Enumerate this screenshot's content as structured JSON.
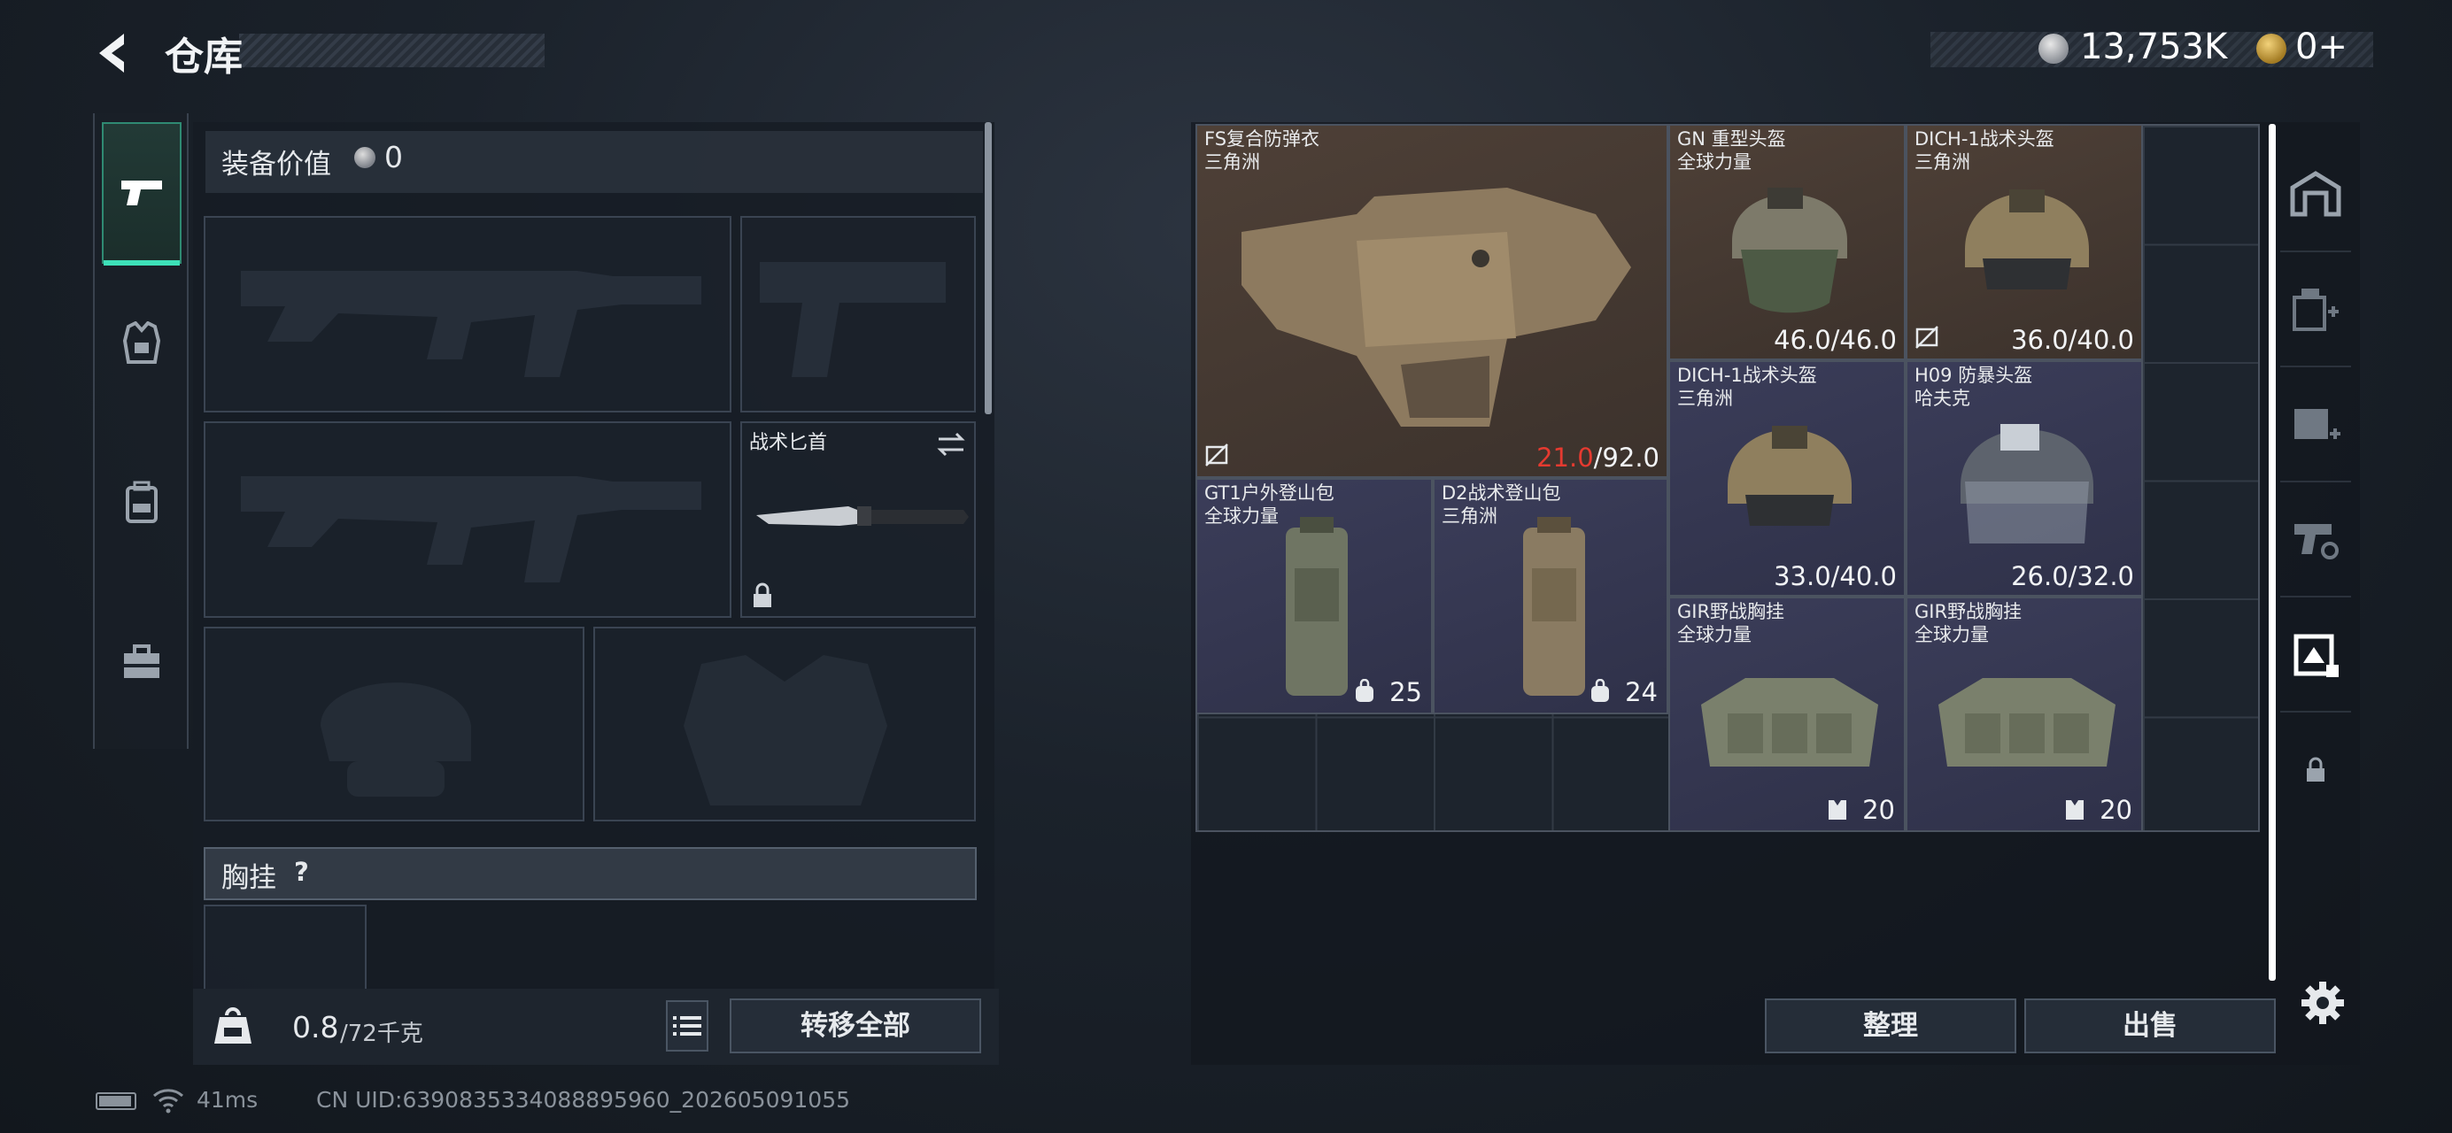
{
  "header": {
    "title": "仓库"
  },
  "currency": {
    "money": "13,753K",
    "tokens": "0+"
  },
  "left_panel": {
    "equipment_value_label": "装备价值",
    "equipment_value": "0",
    "melee_slot_label": "战术匕首",
    "vest_label": "胸挂",
    "vest_help": "?",
    "weight_current": "0.8",
    "weight_max": "/72千克",
    "transfer_all": "转移全部"
  },
  "items": [
    {
      "name": "FS复合防弹衣",
      "sub": "三角洲",
      "dur_cur": "21.0",
      "dur_max": "/92.0",
      "rarity": "brown"
    },
    {
      "name": "GN 重型头盔",
      "sub": "全球力量",
      "durability": "46.0/46.0",
      "rarity": "brown"
    },
    {
      "name": "DICH-1战术头盔",
      "sub": "三角洲",
      "durability": "36.0/40.0",
      "rarity": "brown"
    },
    {
      "name": "DICH-1战术头盔",
      "sub": "三角洲",
      "durability": "33.0/40.0",
      "rarity": "purple"
    },
    {
      "name": "H09 防暴头盔",
      "sub": "哈夫克",
      "durability": "26.0/32.0",
      "rarity": "purple"
    },
    {
      "name": "GT1户外登山包",
      "sub": "全球力量",
      "capacity": "25",
      "rarity": "purple"
    },
    {
      "name": "D2战术登山包",
      "sub": "三角洲",
      "capacity": "24",
      "rarity": "purple"
    },
    {
      "name": "GIR野战胸挂",
      "sub": "全球力量",
      "capacity": "20",
      "rarity": "purple"
    },
    {
      "name": "GIR野战胸挂",
      "sub": "全球力量",
      "capacity": "20",
      "rarity": "purple"
    }
  ],
  "buttons": {
    "organize": "整理",
    "sell": "出售"
  },
  "status_bar": {
    "ping": "41ms",
    "uid": "CN UID:6390835334088895960_202605091055"
  },
  "colors": {
    "accent": "#3de0b8",
    "rarity_brown": "#4e4037",
    "rarity_purple": "#3b3d59",
    "durability_low": "#e53a30"
  },
  "icons": [
    "back-arrow-icon",
    "silver-coin-icon",
    "gold-coin-icon",
    "pistol-icon",
    "armor-icon",
    "backpack-icon",
    "toolbox-icon",
    "swap-icon",
    "lock-icon",
    "weight-icon",
    "list-icon",
    "broken-icon",
    "capacity-icon",
    "settings-icon"
  ]
}
